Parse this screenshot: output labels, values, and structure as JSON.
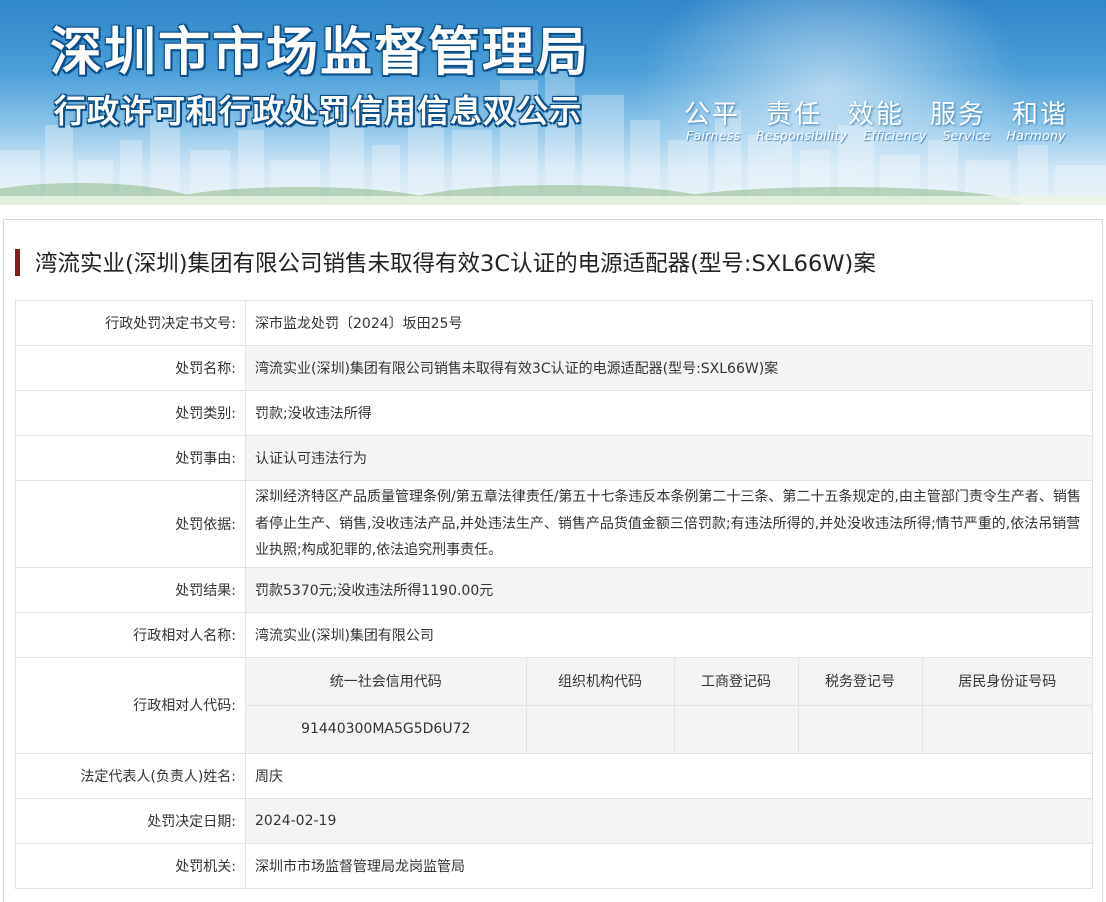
{
  "banner": {
    "title": "深圳市市场监督管理局",
    "subtitle": "行政许可和行政处罚信用信息双公示",
    "slogans_cn": [
      "公平",
      "责任",
      "效能",
      "服务",
      "和谐"
    ],
    "slogans_en": [
      "Fairness",
      "Responsibility",
      "Efficiency",
      "Service",
      "Harmony"
    ]
  },
  "case": {
    "title": "湾流实业(深圳)集团有限公司销售未取得有效3C认证的电源适配器(型号:SXL66W)案"
  },
  "fields": {
    "doc_no": {
      "label": "行政处罚决定书文号:",
      "value": "深市监龙处罚〔2024〕坂田25号"
    },
    "penalty_name": {
      "label": "处罚名称:",
      "value": "湾流实业(深圳)集团有限公司销售未取得有效3C认证的电源适配器(型号:SXL66W)案"
    },
    "penalty_type": {
      "label": "处罚类别:",
      "value": "罚款;没收违法所得"
    },
    "penalty_reason": {
      "label": "处罚事由:",
      "value": "认证认可违法行为"
    },
    "penalty_basis": {
      "label": "处罚依据:",
      "value": "深圳经济特区产品质量管理条例/第五章法律责任/第五十七条违反本条例第二十三条、第二十五条规定的,由主管部门责令生产者、销售者停止生产、销售,没收违法产品,并处违法生产、销售产品货值金额三倍罚款;有违法所得的,并处没收违法所得;情节严重的,依法吊销营业执照;构成犯罪的,依法追究刑事责任。"
    },
    "penalty_result": {
      "label": "处罚结果:",
      "value": "罚款5370元;没收违法所得1190.00元"
    },
    "party_name": {
      "label": "行政相对人名称:",
      "value": "湾流实业(深圳)集团有限公司"
    },
    "party_code": {
      "label": "行政相对人代码:"
    },
    "legal_rep": {
      "label": "法定代表人(负责人)姓名:",
      "value": "周庆"
    },
    "decision_date": {
      "label": "处罚决定日期:",
      "value": "2024-02-19"
    },
    "authority": {
      "label": "处罚机关:",
      "value": "深圳市市场监督管理局龙岗监管局"
    }
  },
  "codes": {
    "headers": [
      "统一社会信用代码",
      "组织机构代码",
      "工商登记码",
      "税务登记号",
      "居民身份证号码"
    ],
    "values": [
      "91440300MA5G5D6U72",
      "",
      "",
      "",
      ""
    ]
  },
  "colors": {
    "title_bar": "#8b1a1a",
    "banner_top": "#2f86c9",
    "row_alt_bg": "#f4f4f4",
    "border": "#e2e2e2"
  }
}
